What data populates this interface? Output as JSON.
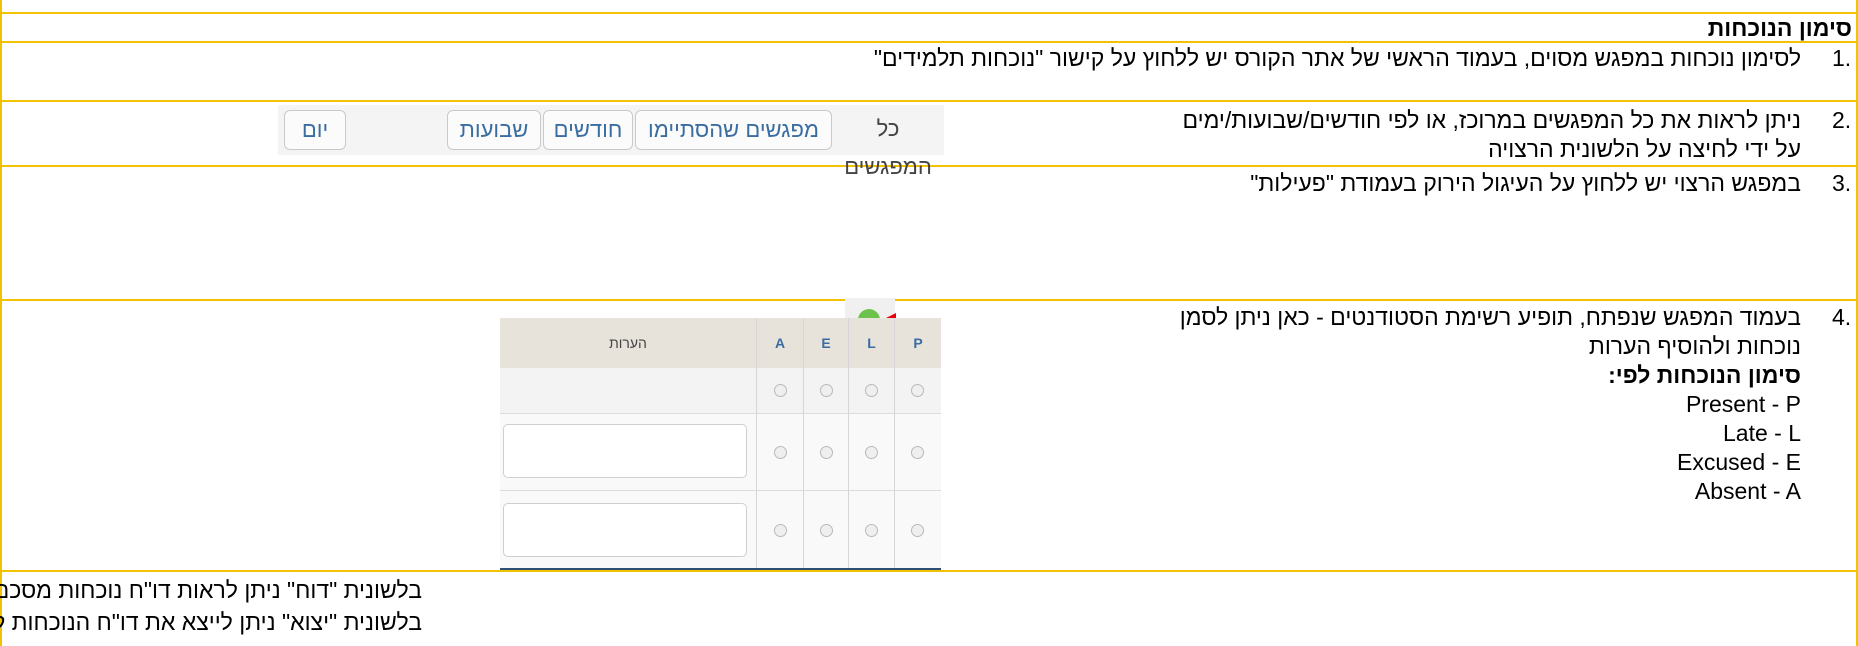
{
  "section_title": "סימון הנוכחות",
  "steps": [
    {
      "num": "1.",
      "text": "לסימון נוכחות במפגש מסוים, בעמוד הראשי של אתר הקורס יש ללחוץ על קישור \"נוכחות תלמידים\""
    },
    {
      "num": "2.",
      "line1": "ניתן לראות את כל המפגשים במרוכז, או לפי חודשים/שבועות/ימים",
      "line2": "על ידי לחיצה על הלשונית הרצויה"
    },
    {
      "num": "3.",
      "text": "במפגש הרצוי יש ללחוץ על העיגול הירוק בעמודת \"פעילות\""
    },
    {
      "num": "4.",
      "line1": "בעמוד המפגש שנפתח, תופיע רשימת הסטודנטים - כאן ניתן לסמן",
      "line2": "נוכחות ולהוסיף הערות",
      "legend_title": "סימון הנוכחות לפי:",
      "legend": [
        "Present - P",
        "Late - L",
        "Excused - E",
        "Absent - A"
      ]
    }
  ],
  "footer": [
    "בלשונית \"דוח\" ניתן לראות דו\"ח נוכחות מסכם",
    "בלשונית \"יצוא\" ניתן לייצא את דו\"ח הנוכחות ל-Excel"
  ],
  "tabs": [
    "כל המפגשים",
    "מפגשים שהסתיימו",
    "חודשים",
    "שבועות",
    "יום"
  ],
  "actions": {
    "take_attendance_icon": "green-circle",
    "settings_icon": "gear",
    "delete_icon": "x",
    "arrow_color": "#e8000b"
  },
  "attendance_table": {
    "columns": [
      "P",
      "L",
      "E",
      "A"
    ],
    "note_header": "הערות",
    "rows": 3
  },
  "colors": {
    "rule": "#f2c200",
    "link_blue": "#3a6da1",
    "active_green": "#6cc24a"
  }
}
